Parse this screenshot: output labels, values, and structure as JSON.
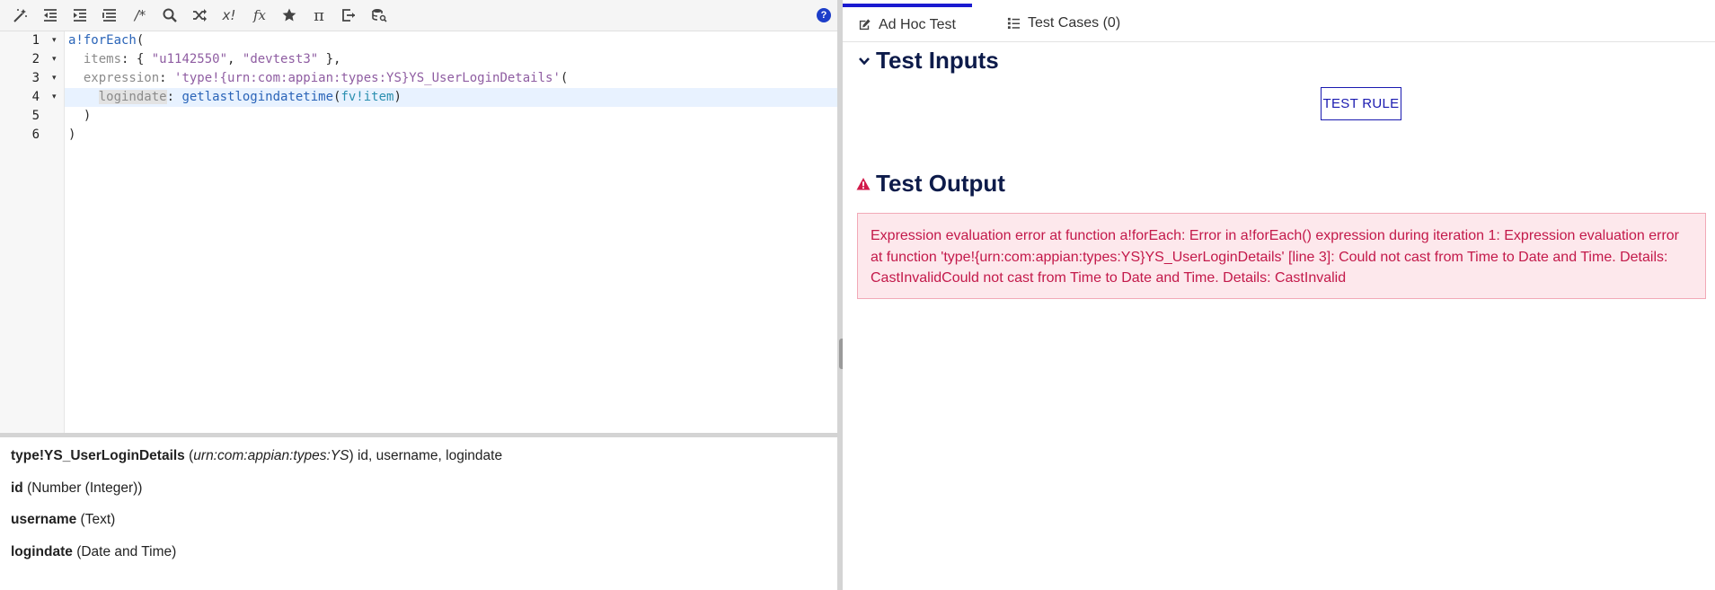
{
  "toolbar": {
    "buttons": [
      {
        "name": "magic-wand-icon"
      },
      {
        "name": "outdent-icon"
      },
      {
        "name": "indent-icon"
      },
      {
        "name": "format-list-icon"
      },
      {
        "name": "comment-icon",
        "glyph": "/*"
      },
      {
        "name": "search-icon"
      },
      {
        "name": "shuffle-icon"
      },
      {
        "name": "not-icon",
        "glyph": "x!"
      },
      {
        "name": "function-icon",
        "glyph": "fx"
      },
      {
        "name": "star-icon"
      },
      {
        "name": "pi-icon",
        "glyph": "π"
      },
      {
        "name": "export-icon"
      },
      {
        "name": "database-search-icon"
      }
    ],
    "help_glyph": "?"
  },
  "editor": {
    "line_numbers": [
      "1",
      "2",
      "3",
      "4",
      "5",
      "6"
    ],
    "fold_markers": [
      "▾",
      "▾",
      "▾",
      "▾",
      "",
      ""
    ],
    "lines": {
      "l1_fn": "a!forEach",
      "l1_rest": "(",
      "l2_indent": "  ",
      "l2_key": "items",
      "l2_p1": ": { ",
      "l2_s1": "\"u1142550\"",
      "l2_p2": ", ",
      "l2_s2": "\"devtest3\"",
      "l2_p3": " },",
      "l3_indent": "  ",
      "l3_key": "expression",
      "l3_p1": ": ",
      "l3_str": "'type!{urn:com:appian:types:YS}YS_UserLoginDetails'",
      "l3_p2": "(",
      "l4_indent": "    ",
      "l4_key": "logindate",
      "l4_p1": ": ",
      "l4_fn": "getlastlogindatetime",
      "l4_p2": "(",
      "l4_kw": "fv!item",
      "l4_p3": ")",
      "l5": "  )",
      "l6": ")"
    }
  },
  "docs": {
    "type_name": "type!YS_UserLoginDetails",
    "type_paren_open": " (",
    "type_ns": "urn:com:appian:types:YS",
    "type_paren_close": ")",
    "type_fields": " id, username, logindate",
    "fields": [
      {
        "name": "id",
        "type": " (Number (Integer))"
      },
      {
        "name": "username",
        "type": " (Text)"
      },
      {
        "name": "logindate",
        "type": " (Date and Time)"
      }
    ]
  },
  "tabs": [
    {
      "label": "Ad Hoc Test",
      "icon": "edit-icon",
      "active": true
    },
    {
      "label": "Test Cases (0)",
      "icon": "list-icon",
      "active": false
    }
  ],
  "test_inputs": {
    "title": "Test Inputs",
    "button_label": "TEST RULE"
  },
  "test_output": {
    "title": "Test Output",
    "error": "Expression evaluation error at function a!forEach: Error in a!forEach() expression during iteration 1: Expression evaluation error at function 'type!{urn:com:appian:types:YS}YS_UserLoginDetails' [line 3]: Could not cast from Time to Date and Time. Details: CastInvalidCould not cast from Time to Date and Time. Details: CastInvalid"
  },
  "colors": {
    "accent": "#1a1ad0",
    "title": "#0d1b4a",
    "error_text": "#c3194a",
    "error_bg": "#fde8ec",
    "warning_icon": "#d11a4a"
  }
}
